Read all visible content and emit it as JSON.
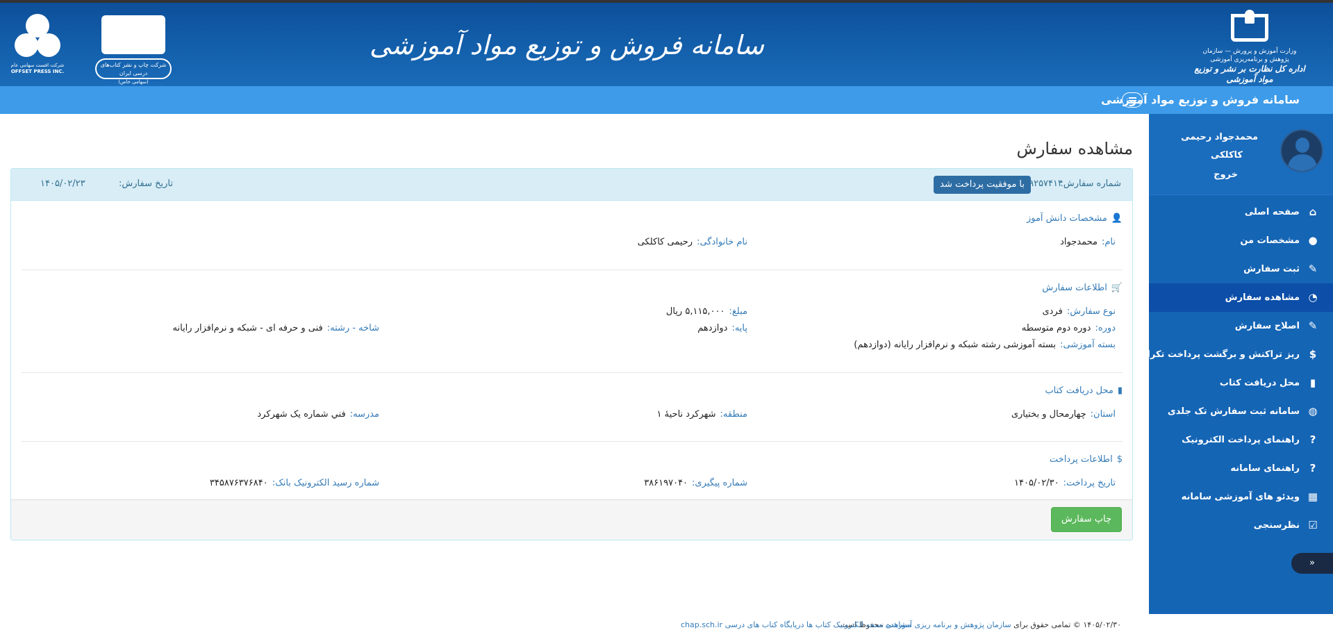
{
  "header": {
    "title": "سامانه فروش و توزیع مواد آموزشی",
    "gov_org": "وزارت آموزش و پرورش — سازمان پژوهش و برنامه‌ریزی آموزشی",
    "gov_dept": "اداره کل نظارت بر نشر و توزیع مواد آموزشی",
    "publisher_name": "شرکت چاپ و نشر کتاب‌های درسی ایران",
    "publisher_sub": "(سهامی خاص)",
    "offset_fa": "شرکت افست سهامی عام",
    "offset_en": "OFFSET PRESS INC."
  },
  "navbar": {
    "title": "سامانه فروش و توزیع مواد آموزشی"
  },
  "profile": {
    "name": "محمدجواد رحیمی",
    "family": "کاکلکی",
    "logout": "خروج"
  },
  "menu": [
    {
      "label": "صفحه اصلی",
      "icon": "home-icon",
      "glyph": "⌂"
    },
    {
      "label": "مشخصات من",
      "icon": "user-icon",
      "glyph": "●"
    },
    {
      "label": "ثبت سفارش",
      "icon": "edit-icon",
      "glyph": "✎"
    },
    {
      "label": "مشاهده سفارش",
      "icon": "dashboard-icon",
      "glyph": "◔"
    },
    {
      "label": "اصلاح سفارش",
      "icon": "edit-icon",
      "glyph": "✎"
    },
    {
      "label": "ریز تراکنش و برگشت پرداخت تکراری",
      "icon": "dollar-icon",
      "glyph": "$"
    },
    {
      "label": "محل دریافت کتاب",
      "icon": "book-icon",
      "glyph": "▮"
    },
    {
      "label": "سامانه ثبت سفارش تک جلدی",
      "icon": "globe-icon",
      "glyph": "◍"
    },
    {
      "label": "راهنمای پرداخت الکترونیک",
      "icon": "question-icon",
      "glyph": "?"
    },
    {
      "label": "راهنمای سامانه",
      "icon": "question-icon",
      "glyph": "?"
    },
    {
      "label": "ویدئو های آموزشی سامانه",
      "icon": "film-icon",
      "glyph": "▦"
    },
    {
      "label": "نظرسنجی",
      "icon": "check-square-icon",
      "glyph": "☑"
    }
  ],
  "collapse": "«",
  "page": {
    "title": "مشاهده سفارش"
  },
  "order": {
    "number_label": "شماره سفارش:",
    "number": "۹۲۵۷۴۱۴",
    "status": "با موفقیت پرداخت شد",
    "date_label": "تاریخ سفارش:",
    "date": "۱۴۰۵/۰۲/۲۳"
  },
  "student": {
    "title": "مشخصات دانش آموز",
    "first_name_label": "نام:",
    "first_name": "محمدجواد",
    "last_name_label": "نام خانوادگی:",
    "last_name": "رحیمی کاکلکی"
  },
  "order_info": {
    "title": "اطلاعات سفارش",
    "type_label": "نوع سفارش:",
    "type": "فردی",
    "amount_label": "مبلغ:",
    "amount": "۵,۱۱۵,۰۰۰ ریال",
    "period_label": "دوره:",
    "period": "دوره دوم متوسطه",
    "grade_label": "پایه:",
    "grade": "دوازدهم",
    "branch_label": "شاخه - رشته:",
    "branch": "فنی و حرفه ای - شبکه و نرم‌افزار رایانه",
    "package_label": "بسته آموزشی:",
    "package": "بسته آموزشی رشته شبکه و نرم‌افزار رایانه (دوازدهم)"
  },
  "delivery": {
    "title": "محل دریافت کتاب",
    "province_label": "استان:",
    "province": "چهارمحال و بختیاری",
    "region_label": "منطقه:",
    "region": "شهرکرد ناحیهٔ ۱",
    "school_label": "مدرسه:",
    "school": "فني شماره يک شهرکرد"
  },
  "payment": {
    "title": "اطلاعات پرداخت",
    "date_label": "تاریخ پرداخت:",
    "date": "۱۴۰۵/۰۲/۳۰",
    "tracking_label": "شماره پیگیری:",
    "tracking": "۳۸۶۱۹۷۰۴۰",
    "receipt_label": "شماره رسید الکترونیک بانک:",
    "receipt": "۳۴۵۸۷۶۳۷۶۸۴۰"
  },
  "actions": {
    "print": "چاپ سفارش"
  },
  "footer": {
    "copyright_prefix": "۱۴۰۵/۰۲/۳۰ © تمامی حقوق برای",
    "copyright_link": "سازمان پژوهش و برنامه ریزی آموزشی",
    "copyright_suffix": "محفوظ است.",
    "center_text": "مشاهده نسخه الکترونیک کتاب ها درپایگاه کتاب های درسی",
    "center_link": "chap.sch.ir"
  },
  "colors": {
    "banner": "#0d4f9a",
    "navbar": "#3d9be9",
    "sidebar": "#1565b5",
    "sidebar_active": "#0c4ea8",
    "panel_heading": "#d9edf7",
    "status_badge": "#2e6da4",
    "print_button": "#5cb85c",
    "label": "#337ab7"
  }
}
